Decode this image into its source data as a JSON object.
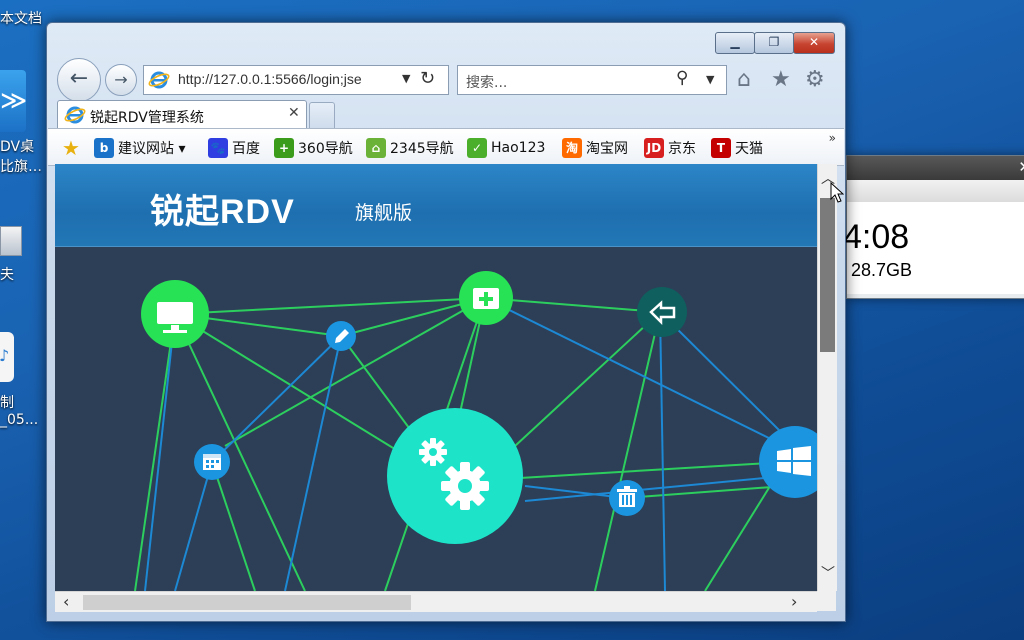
{
  "desktop": {
    "top_label": "本文档",
    "icon1_line1": "DV桌",
    "icon1_line2": "比旗…",
    "icon2_label": "夫",
    "icon3_line1": "制",
    "icon3_line2": "_05..."
  },
  "background_window": {
    "close": "✕",
    "time": "4:08",
    "size": "28.7GB"
  },
  "browser": {
    "back": "←",
    "forward": "→",
    "address_url": "http://127.0.0.1:5566/login;jse",
    "search_placeholder": "搜索...",
    "tab_title": "锐起RDV管理系统",
    "tab_close": "✕",
    "favorites": [
      {
        "label": "建议网站 ▾",
        "icon": "bing-icon",
        "color": "#1a73c9"
      },
      {
        "label": "百度",
        "icon": "baidu-paw-icon",
        "color": "#2f3ee0"
      },
      {
        "label": "360导航",
        "icon": "360-plus-icon",
        "color": "#3b9c1c"
      },
      {
        "label": "2345导航",
        "icon": "2345-house-icon",
        "color": "#6bb338"
      },
      {
        "label": "Hao123",
        "icon": "hao123-check-icon",
        "color": "#4caf2c"
      },
      {
        "label": "淘宝网",
        "icon": "taobao-icon",
        "color": "#ff6a00"
      },
      {
        "label": "京东",
        "icon": "jd-icon",
        "color": "#d71f1f"
      },
      {
        "label": "天猫",
        "icon": "tmall-icon",
        "color": "#c40000"
      }
    ],
    "fav_icon_text": [
      "b",
      "🐾",
      "+",
      "⌂",
      "✓",
      "淘",
      "JD",
      "T"
    ],
    "more_chevron": "»"
  },
  "page": {
    "logo_main": "锐起RDV",
    "logo_sub": "旗舰版",
    "colors": {
      "header": "#1e6faf",
      "body": "#2c3f56",
      "green": "#27e255",
      "cyan": "#1de3c9",
      "blue": "#1b95e0",
      "teal": "#0f5d5d"
    },
    "network_nodes": [
      {
        "name": "monitor-node",
        "icon": "monitor-icon"
      },
      {
        "name": "add-node",
        "icon": "add-box-icon"
      },
      {
        "name": "back-arrow-node",
        "icon": "back-arrow-icon"
      },
      {
        "name": "edit-node",
        "icon": "pencil-icon"
      },
      {
        "name": "calendar-node",
        "icon": "calendar-icon"
      },
      {
        "name": "settings-node",
        "icon": "gears-icon"
      },
      {
        "name": "trash-node",
        "icon": "trash-icon"
      },
      {
        "name": "windows-node",
        "icon": "windows-logo-icon"
      }
    ]
  }
}
